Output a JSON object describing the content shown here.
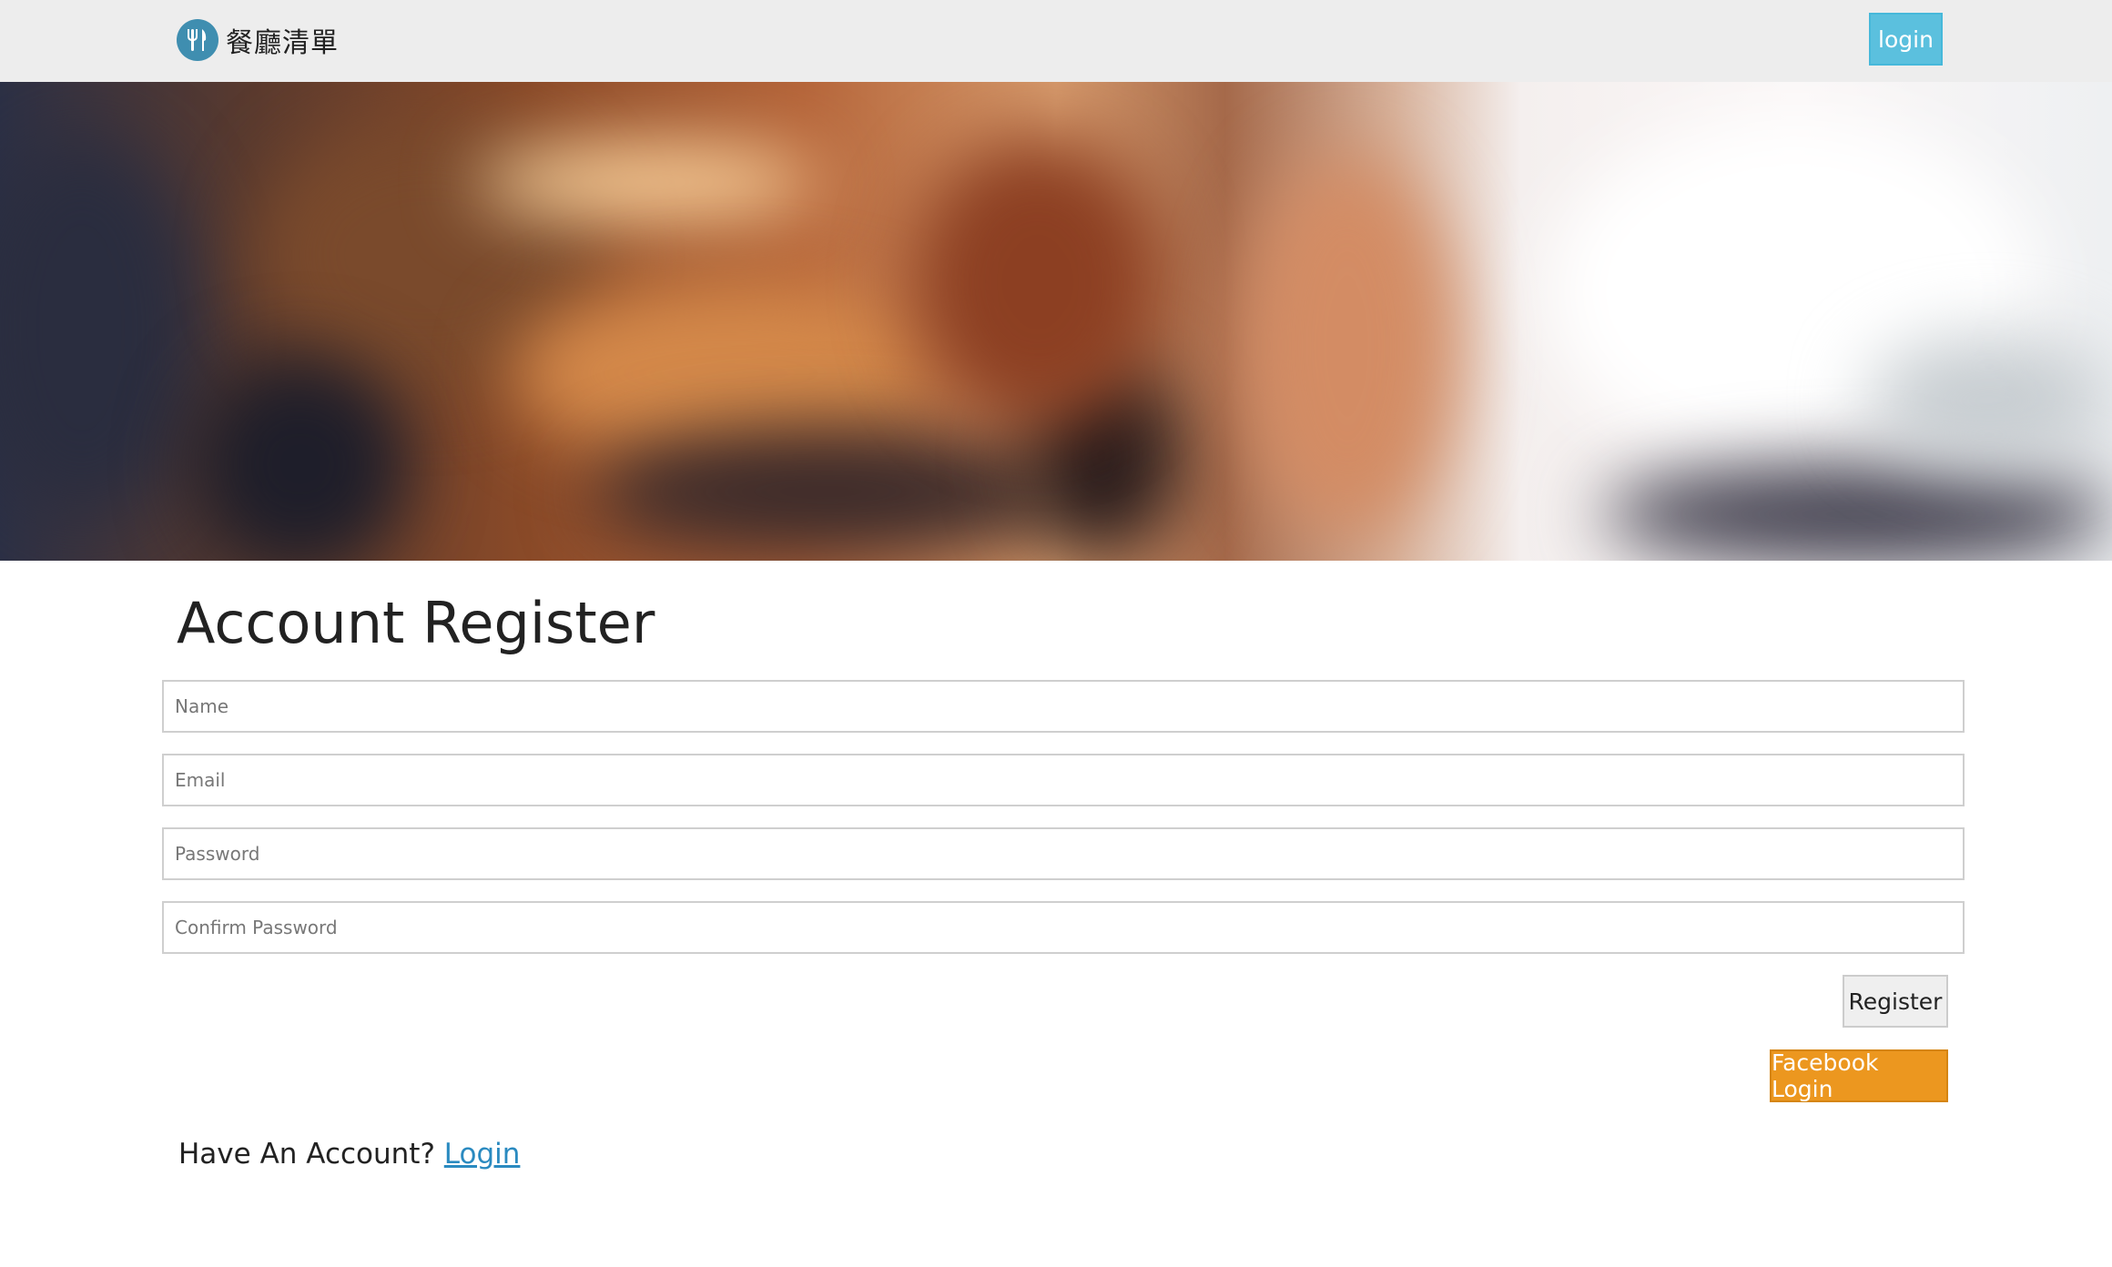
{
  "header": {
    "brand_name": "餐廳清單",
    "logo_icon": "fork-knife-icon",
    "login_label": "login",
    "accent_color": "#5bc0de"
  },
  "hero": {
    "description_icon": "blurred-restaurant-interior-image"
  },
  "form": {
    "title": "Account Register",
    "fields": {
      "name_placeholder": "Name",
      "email_placeholder": "Email",
      "password_placeholder": "Password",
      "confirm_password_placeholder": "Confirm Password"
    },
    "register_label": "Register",
    "facebook_label": "Facebook Login",
    "facebook_color": "#ec971f"
  },
  "footer": {
    "have_account_text": "Have An Account?",
    "login_link": "Login"
  }
}
